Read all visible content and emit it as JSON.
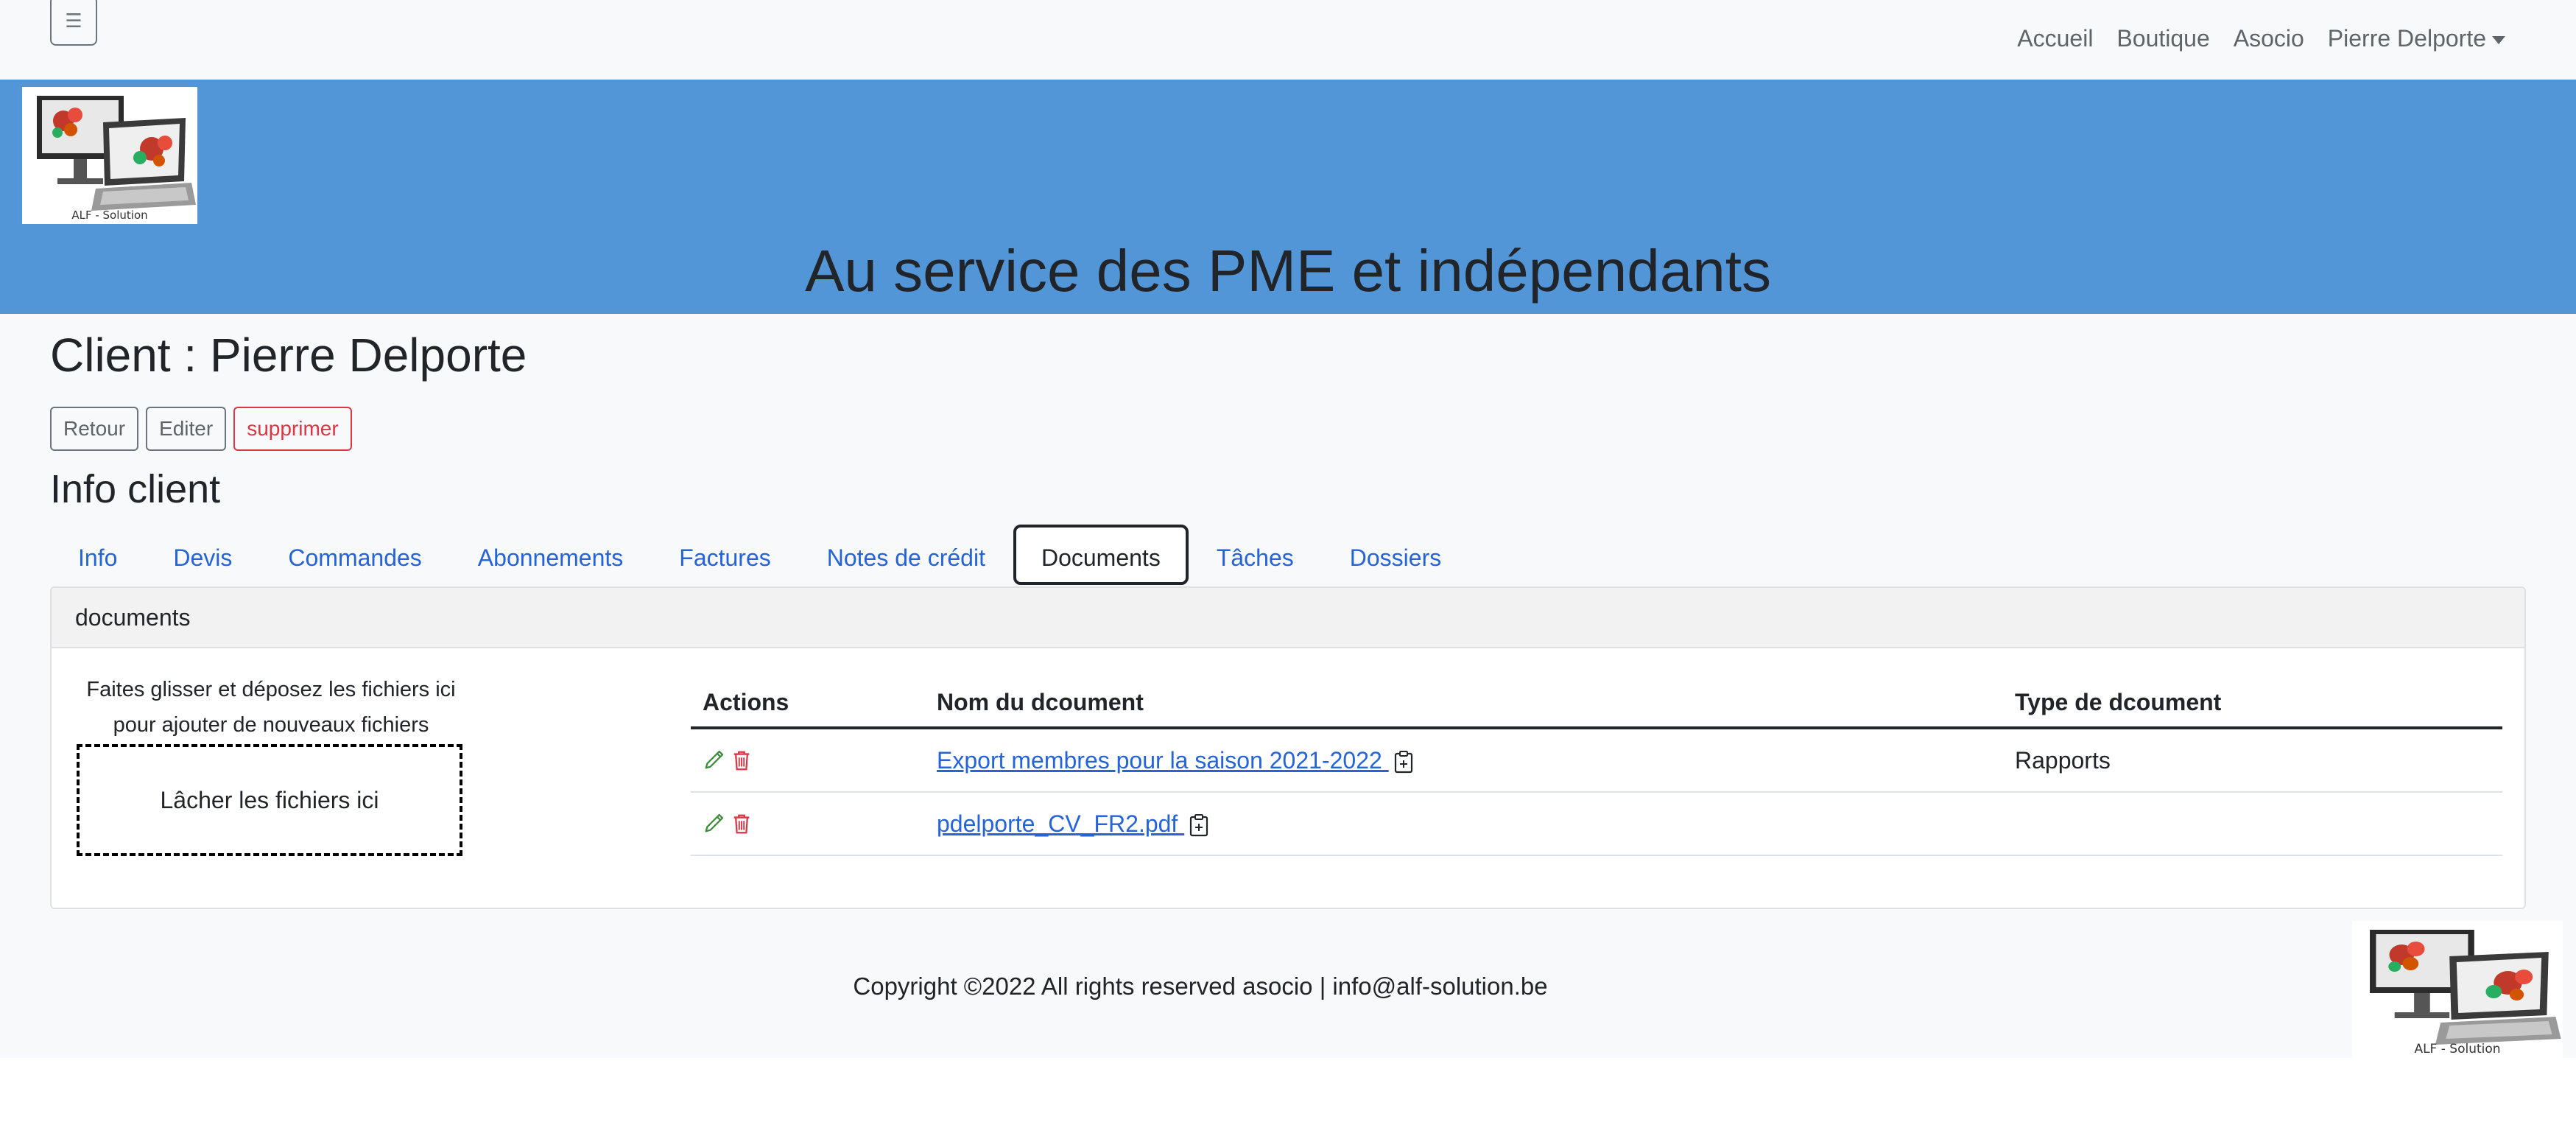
{
  "navbar": {
    "toggler_icon": "hamburger-icon",
    "links": [
      "Accueil",
      "Boutique",
      "Asocio",
      "Pierre Delporte"
    ]
  },
  "banner": {
    "logo_caption": "ALF - Solution",
    "title": "Au service des PME et indépendants",
    "background": "#5296d8"
  },
  "client": {
    "title": "Client : Pierre Delporte",
    "buttons": {
      "back": "Retour",
      "edit": "Editer",
      "delete": "supprimer"
    }
  },
  "section": {
    "title": "Info client"
  },
  "tabs": [
    {
      "label": "Info"
    },
    {
      "label": "Devis"
    },
    {
      "label": "Commandes"
    },
    {
      "label": "Abonnements"
    },
    {
      "label": "Factures"
    },
    {
      "label": "Notes de crédit"
    },
    {
      "label": "Documents",
      "active": true
    },
    {
      "label": "Tâches"
    },
    {
      "label": "Dossiers"
    }
  ],
  "documents": {
    "header": "documents",
    "drop_hint_line1": "Faites glisser et déposez les fichiers ici",
    "drop_hint_line2": "pour ajouter de nouveaux fichiers",
    "drop_zone": "Lâcher les fichiers ici",
    "columns": [
      "Actions",
      "Nom du dcoument",
      "Type de dcoument"
    ],
    "rows": [
      {
        "name": "Export membres pour la saison 2021-2022 ",
        "type": "Rapports"
      },
      {
        "name": "pdelporte_CV_FR2.pdf ",
        "type": ""
      }
    ]
  },
  "footer": {
    "text": "Copyright ©2022 All rights reserved asocio | info@alf-solution.be",
    "logo_caption": "ALF - Solution"
  },
  "colors": {
    "link": "#2563d9",
    "danger": "#dc3545",
    "edit_icon": "#3c8c3c"
  }
}
